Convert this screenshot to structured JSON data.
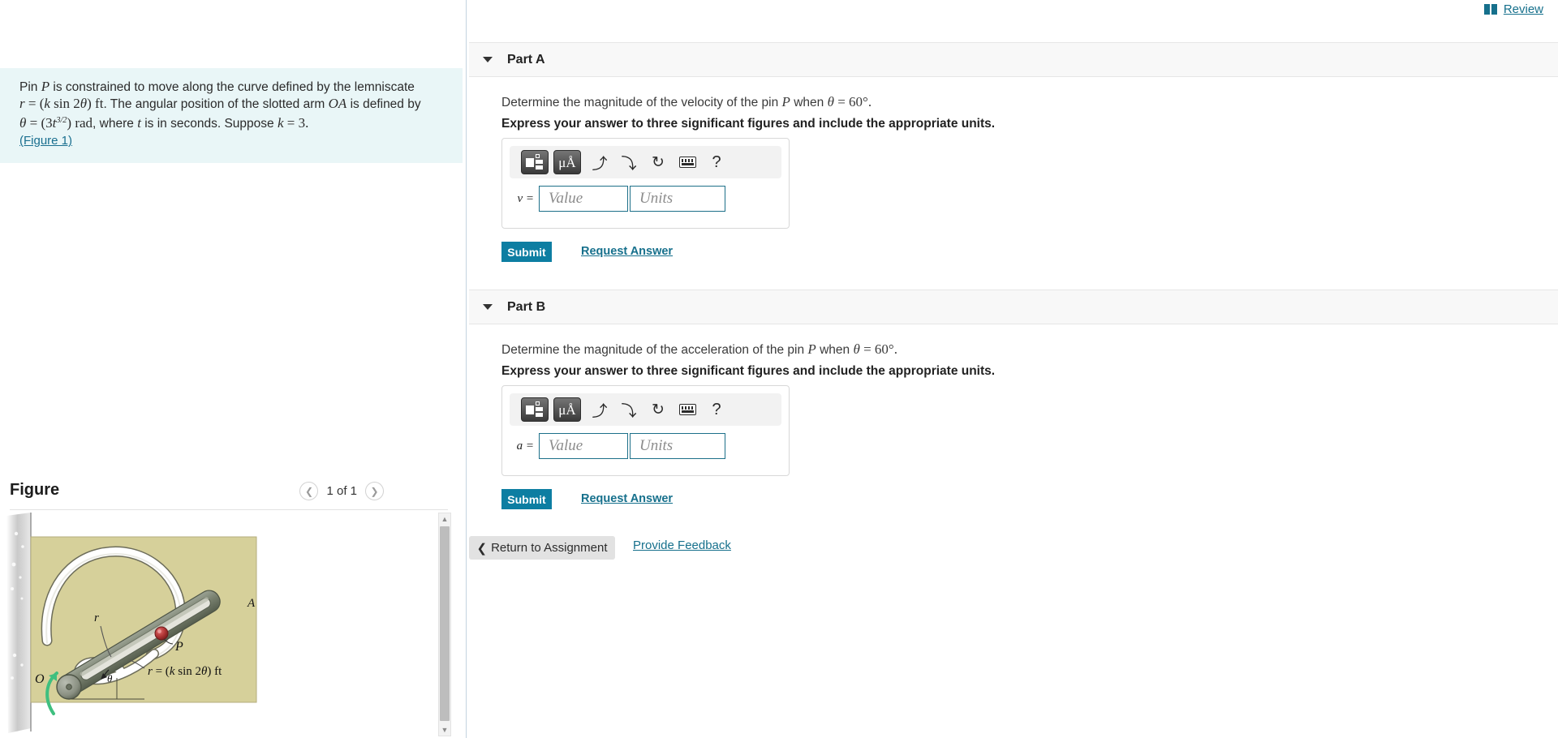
{
  "top": {
    "review_label": "Review",
    "book_icon": "book-icon"
  },
  "left": {
    "question": {
      "line1_a": "Pin ",
      "line1_P": "P",
      "line1_b": " is constrained to move along the curve defined by the lemniscate",
      "line2_r": "r",
      "line2_eq": " = (",
      "line2_k": "k",
      "line2_sin": " sin 2",
      "line2_theta": "θ",
      "line2_close": ") ",
      "line2_ft": "ft",
      "line2_rest": ". The angular position of the slotted arm ",
      "line2_OA": "OA",
      "line2_tail": " is defined by",
      "line3_theta": "θ",
      "line3_eq": " = (3",
      "line3_t": "t",
      "line3_exp": "3/2",
      "line3_close": ") ",
      "line3_rad": "rad",
      "line3_rest": ", where ",
      "line3_t2": "t",
      "line3_rest2": " is in seconds. Suppose ",
      "line3_k": "k",
      "line3_kval": " = 3."
    },
    "figure_link": "(Figure 1)",
    "figure_title": "Figure",
    "figure_count": "1 of 1",
    "prev_icon": "chevron-left-icon",
    "next_icon": "chevron-right-icon",
    "figure_labels": {
      "A": "A",
      "O": "O",
      "P": "P",
      "r": "r",
      "theta": "θ",
      "equation": "r = (k sin 2θ) ft"
    },
    "figure_colors": {
      "background": "#d6d09a",
      "arm": "#7f8775",
      "wall": "#c9c9c9",
      "pin": "#a83232",
      "arrow": "#3fbf7f",
      "curve": "#ffffff"
    }
  },
  "parts": [
    {
      "id": "a",
      "label": "Part A",
      "caret_icon": "caret-down-icon",
      "prompt_a": "Determine the magnitude of the velocity of the pin ",
      "prompt_P": "P",
      "prompt_b": " when ",
      "prompt_theta": "θ",
      "prompt_val": " = 60°.",
      "instruction": "Express your answer to three significant figures and include the appropriate units.",
      "var_label": "v =",
      "value_placeholder": "Value",
      "units_placeholder": "Units",
      "value_current": "",
      "units_current": "",
      "submit_label": "Submit",
      "request_label": "Request Answer",
      "toolbar": {
        "template_icon": "template-icon",
        "units_icon": "μÅ",
        "undo_icon": "undo-icon",
        "redo_icon": "redo-icon",
        "reset_icon": "reset-icon",
        "keyboard_icon": "keyboard-icon",
        "help_icon": "?"
      }
    },
    {
      "id": "b",
      "label": "Part B",
      "caret_icon": "caret-down-icon",
      "prompt_a": "Determine the magnitude of the acceleration of the pin ",
      "prompt_P": "P",
      "prompt_b": " when ",
      "prompt_theta": "θ",
      "prompt_val": " = 60°.",
      "instruction": "Express your answer to three significant figures and include the appropriate units.",
      "var_label": "a =",
      "value_placeholder": "Value",
      "units_placeholder": "Units",
      "value_current": "",
      "units_current": "",
      "submit_label": "Submit",
      "request_label": "Request Answer",
      "toolbar": {
        "template_icon": "template-icon",
        "units_icon": "μÅ",
        "undo_icon": "undo-icon",
        "redo_icon": "redo-icon",
        "reset_icon": "reset-icon",
        "keyboard_icon": "keyboard-icon",
        "help_icon": "?"
      }
    }
  ],
  "footer": {
    "return_label": "Return to Assignment",
    "return_icon": "chevron-left-icon",
    "feedback_label": "Provide Feedback"
  },
  "theme": {
    "accent_teal": "#0d7ea2",
    "link_teal": "#16708c",
    "question_bg": "#e9f6f7",
    "header_bg": "#f8f8f8"
  }
}
